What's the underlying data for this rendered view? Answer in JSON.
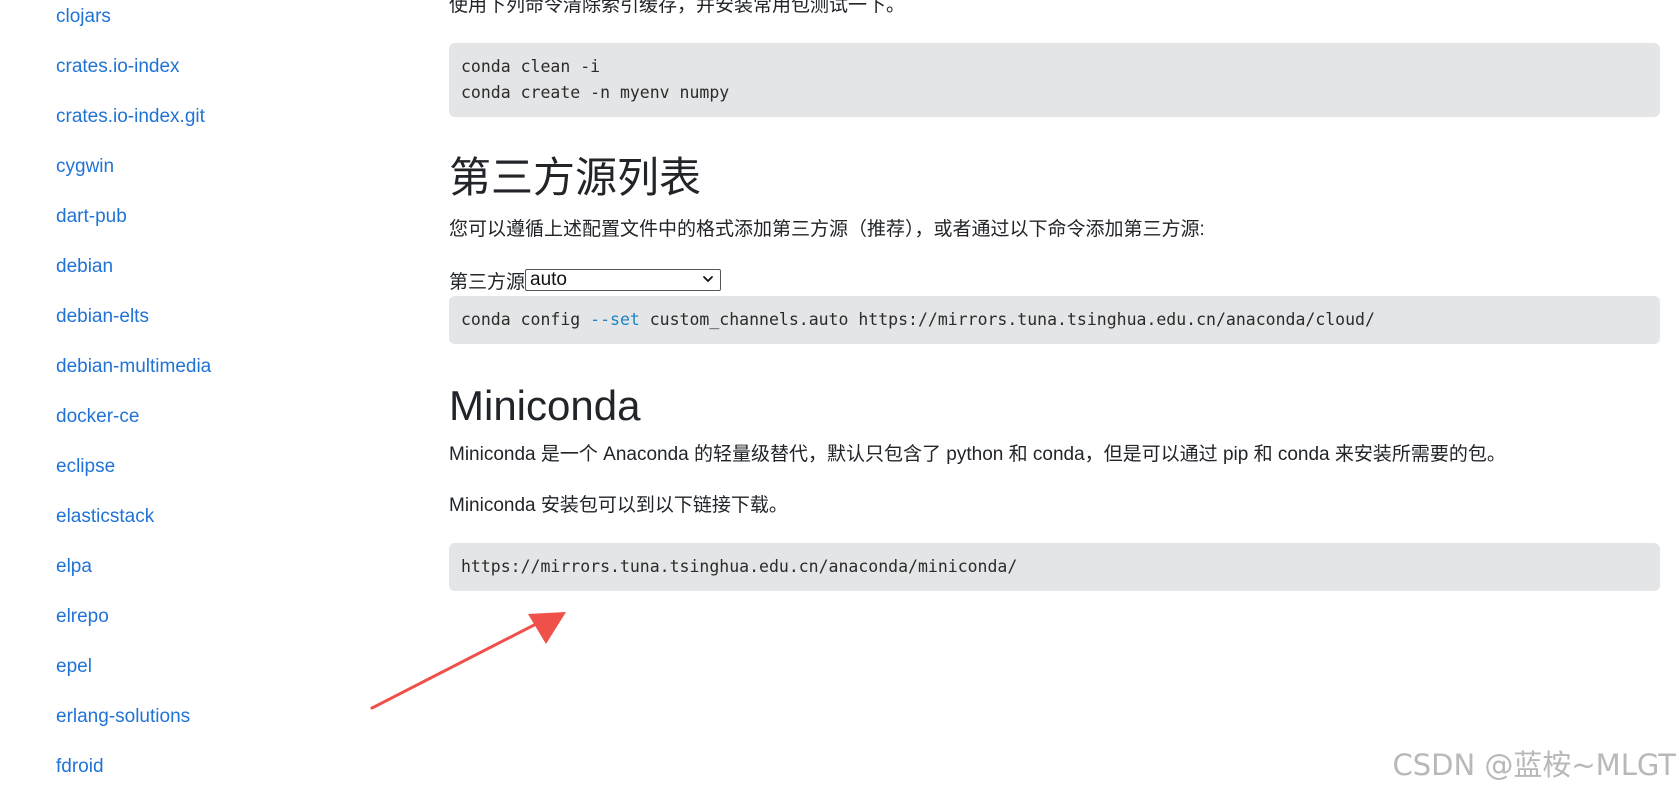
{
  "sidebar": {
    "items": [
      {
        "label": "clojars"
      },
      {
        "label": "crates.io-index"
      },
      {
        "label": "crates.io-index.git"
      },
      {
        "label": "cygwin"
      },
      {
        "label": "dart-pub"
      },
      {
        "label": "debian"
      },
      {
        "label": "debian-elts"
      },
      {
        "label": "debian-multimedia"
      },
      {
        "label": "docker-ce"
      },
      {
        "label": "eclipse"
      },
      {
        "label": "elasticstack"
      },
      {
        "label": "elpa"
      },
      {
        "label": "elrepo"
      },
      {
        "label": "epel"
      },
      {
        "label": "erlang-solutions"
      },
      {
        "label": "fdroid"
      }
    ]
  },
  "main": {
    "intro_text": "使用下列命令清除索引缓存，并安装常用包测试一下。",
    "code_block_1": {
      "lines": [
        "conda clean -i",
        "conda create -n myenv numpy"
      ]
    },
    "third_party": {
      "heading": "第三方源列表",
      "description": "您可以遵循上述配置文件中的格式添加第三方源（推荐），或者通过以下命令添加第三方源:",
      "select_label": "第三方源",
      "select_value": "auto",
      "command_prefix": "conda config ",
      "command_keyword": "--set",
      "command_suffix": " custom_channels.auto https://mirrors.tuna.tsinghua.edu.cn/anaconda/cloud/"
    },
    "miniconda": {
      "heading": "Miniconda",
      "description": "Miniconda 是一个 Anaconda 的轻量级替代，默认只包含了 python 和 conda，但是可以通过 pip 和 conda 来安装所需要的包。",
      "download_text": "Miniconda 安装包可以到以下链接下载。",
      "url": "https://mirrors.tuna.tsinghua.edu.cn/anaconda/miniconda/"
    }
  },
  "annotation": {
    "arrow_color": "#f0504a"
  },
  "watermark": "CSDN @蓝桉~MLGT"
}
